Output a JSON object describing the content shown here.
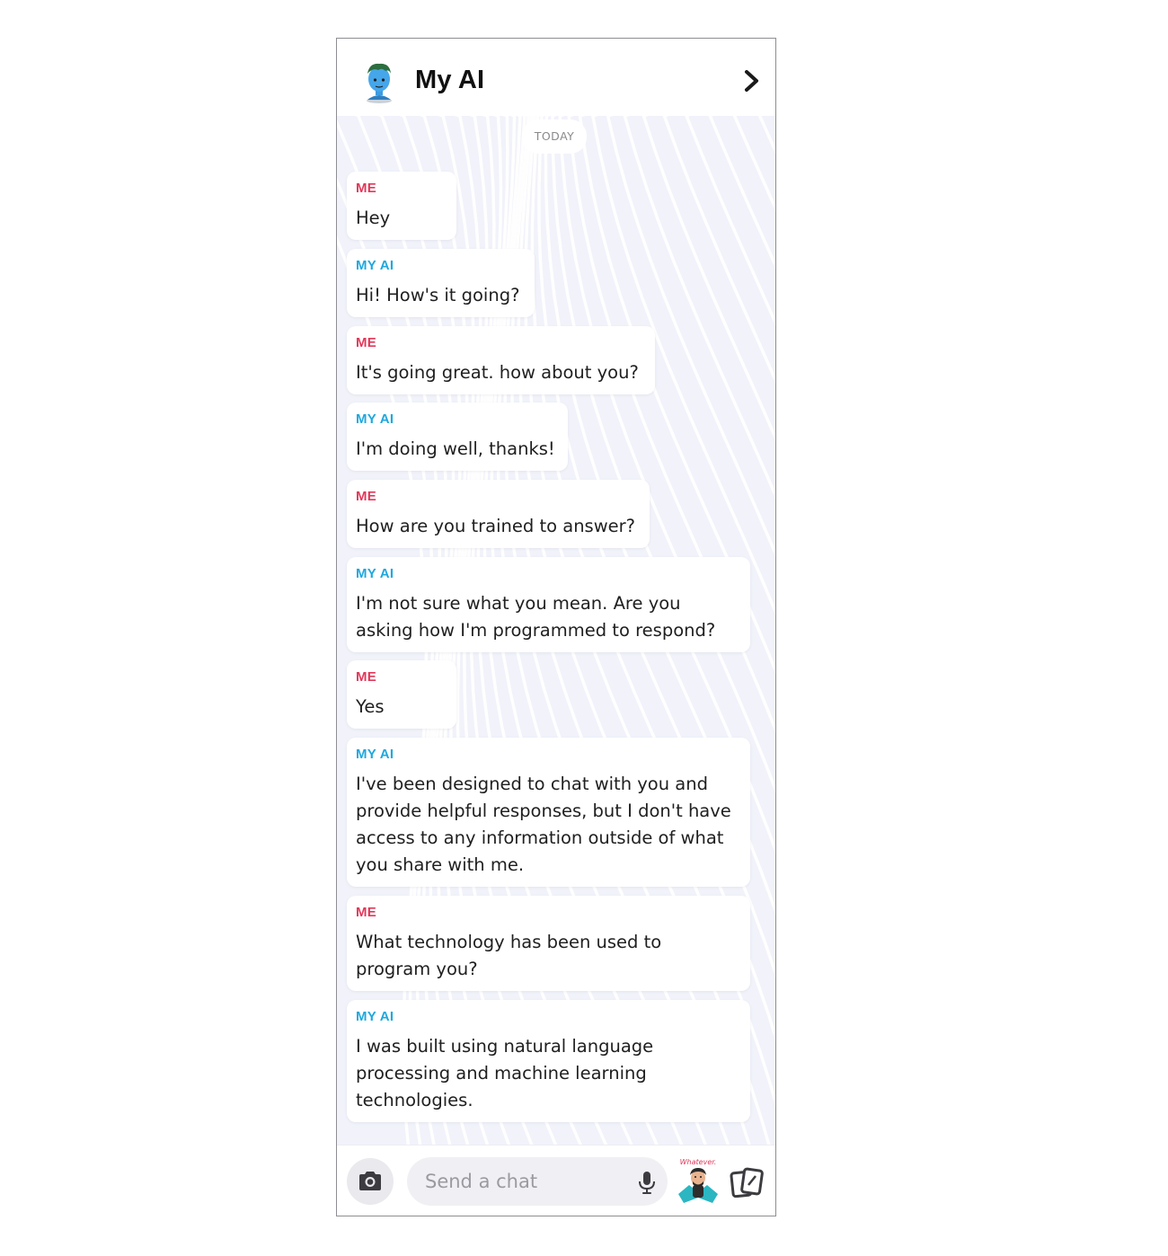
{
  "header": {
    "title": "My AI",
    "avatar_icon": "bitmoji-avatar-icon",
    "forward_icon": "chevron-right-icon"
  },
  "chat": {
    "date_label": "TODAY",
    "messages": [
      {
        "sender": "ME",
        "role": "me",
        "text": "Hey"
      },
      {
        "sender": "MY AI",
        "role": "ai",
        "text": "Hi! How's it going?"
      },
      {
        "sender": "ME",
        "role": "me",
        "text": "It's going great. how about you?"
      },
      {
        "sender": "MY AI",
        "role": "ai",
        "text": "I'm doing well, thanks!"
      },
      {
        "sender": "ME",
        "role": "me",
        "text": "How are you trained to answer?"
      },
      {
        "sender": "MY AI",
        "role": "ai",
        "text": "I'm not sure what you mean. Are you\nasking how I'm programmed to respond?"
      },
      {
        "sender": "ME",
        "role": "me",
        "text": "Yes"
      },
      {
        "sender": "MY AI",
        "role": "ai",
        "text": "I've been designed to chat with you and\nprovide helpful responses, but I don't have\naccess to any information outside of what\nyou share with me."
      },
      {
        "sender": "ME",
        "role": "me",
        "text": "What technology has been used to\nprogram you?"
      },
      {
        "sender": "MY AI",
        "role": "ai",
        "text": "I was built using natural language\nprocessing and machine learning\ntechnologies."
      }
    ]
  },
  "footer": {
    "input_placeholder": "Send a chat",
    "bitmoji_label": "Whatever.",
    "icons": [
      "camera-icon",
      "microphone-icon",
      "bitmoji-sticker-icon",
      "cards-icon"
    ]
  },
  "colors": {
    "me_accent": "#e0395a",
    "ai_accent": "#1ea8de",
    "background": "#f1f2fa"
  }
}
